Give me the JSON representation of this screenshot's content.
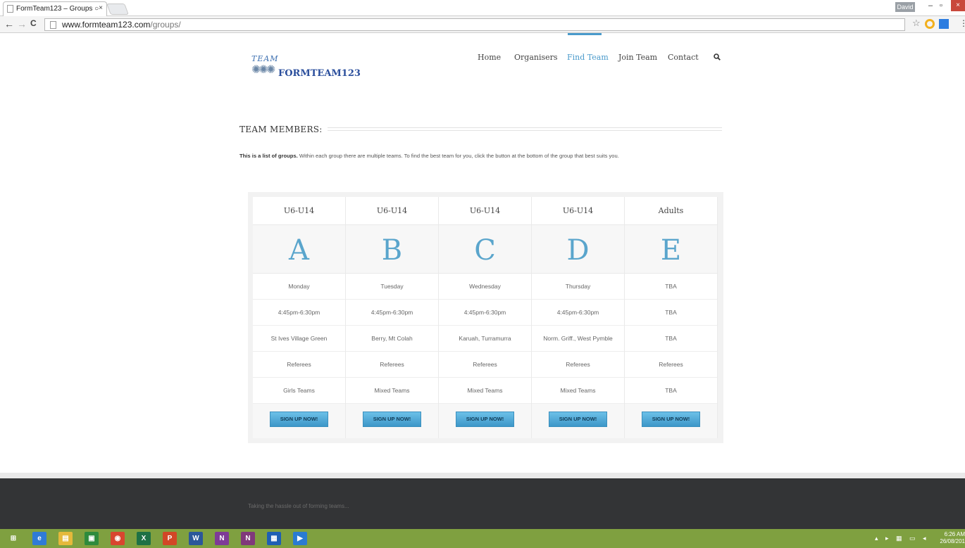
{
  "browser": {
    "tab_title": "FormTeam123 – Groups ○",
    "tab_close": "×",
    "user_badge": "David",
    "url_host": "www.formteam123.com",
    "url_path": "/groups/",
    "min": "–",
    "max": "▫",
    "close": "×",
    "back": "←",
    "forward": "→",
    "reload": "C",
    "star": "☆",
    "menu": "⋮",
    "corner_plus": "+"
  },
  "site": {
    "logo_script": "TEAM",
    "logo_figures": "✺✺✺",
    "logo_text": "FORMTEAM123",
    "nav": [
      {
        "label": "Home"
      },
      {
        "label": "Organisers"
      },
      {
        "label": "Find Team"
      },
      {
        "label": "Join Team"
      },
      {
        "label": "Contact"
      }
    ],
    "section_title": "TEAM MEMBERS:",
    "intro_bold": "This is a list of groups.",
    "intro_rest": " Within each group there are multiple teams. To find the best team for you, click the button at the bottom of the group that best suits you.",
    "groups": [
      {
        "age": "U6-U14",
        "letter": "A",
        "day": "Monday",
        "time": "4:45pm-6:30pm",
        "location": "St Ives Village Green",
        "refs": "Referees",
        "type": "Girls Teams",
        "button": "SIGN UP NOW!"
      },
      {
        "age": "U6-U14",
        "letter": "B",
        "day": "Tuesday",
        "time": "4:45pm-6:30pm",
        "location": "Berry, Mt Colah",
        "refs": "Referees",
        "type": "Mixed Teams",
        "button": "SIGN UP NOW!"
      },
      {
        "age": "U6-U14",
        "letter": "C",
        "day": "Wednesday",
        "time": "4:45pm-6:30pm",
        "location": "Karuah, Turramurra",
        "refs": "Referees",
        "type": "Mixed Teams",
        "button": "SIGN UP NOW!"
      },
      {
        "age": "U6-U14",
        "letter": "D",
        "day": "Thursday",
        "time": "4:45pm-6:30pm",
        "location": "Norm. Griff., West Pymble",
        "refs": "Referees",
        "type": "Mixed Teams",
        "button": "SIGN UP NOW!"
      },
      {
        "age": "Adults",
        "letter": "E",
        "day": "TBA",
        "time": "TBA",
        "location": "TBA",
        "refs": "Referees",
        "type": "TBA",
        "button": "SIGN UP NOW!"
      }
    ],
    "footer_tagline": "Taking the hassle out of forming teams..."
  },
  "taskbar": {
    "apps": [
      {
        "name": "windows-start",
        "glyph": "⊞",
        "color": "#7fa040"
      },
      {
        "name": "internet-explorer",
        "glyph": "e",
        "color": "#2f7bd6"
      },
      {
        "name": "file-explorer",
        "glyph": "▤",
        "color": "#e5b93b"
      },
      {
        "name": "store",
        "glyph": "▣",
        "color": "#2e8b3d"
      },
      {
        "name": "chrome",
        "glyph": "◉",
        "color": "#d8452f"
      },
      {
        "name": "excel",
        "glyph": "X",
        "color": "#1e7145"
      },
      {
        "name": "powerpoint",
        "glyph": "P",
        "color": "#d24726"
      },
      {
        "name": "word",
        "glyph": "W",
        "color": "#2b579a"
      },
      {
        "name": "onenote-alt",
        "glyph": "N",
        "color": "#7e3b97"
      },
      {
        "name": "onenote",
        "glyph": "N",
        "color": "#80397b"
      },
      {
        "name": "app-tiles",
        "glyph": "▦",
        "color": "#1e5fb4"
      },
      {
        "name": "media",
        "glyph": "▶",
        "color": "#2a7bd1"
      }
    ],
    "tray": "▴ ▸ ▦ ▭ ◂",
    "time": "6:26 AM",
    "date": "26/08/201"
  }
}
